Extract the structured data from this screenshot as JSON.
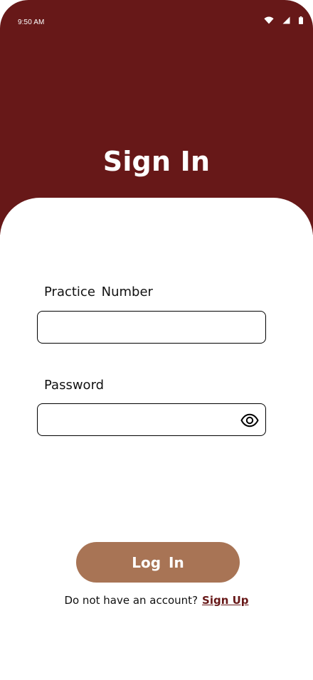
{
  "status_bar": {
    "time": "9:50 AM",
    "icons": [
      "wifi-icon",
      "cellular-signal-icon",
      "battery-icon"
    ]
  },
  "header": {
    "title": "Sign In"
  },
  "form": {
    "practice_number": {
      "label": "Practice  Number",
      "value": "",
      "placeholder": ""
    },
    "password": {
      "label": "Password",
      "value": "",
      "placeholder": "",
      "toggle_icon": "eye-icon"
    },
    "login_button_label": "Log  In"
  },
  "footer": {
    "prompt": "Do not have an account?",
    "signup_link": "Sign Up"
  },
  "colors": {
    "header_bg": "#671818",
    "button_bg": "#a87455",
    "link": "#671818"
  }
}
